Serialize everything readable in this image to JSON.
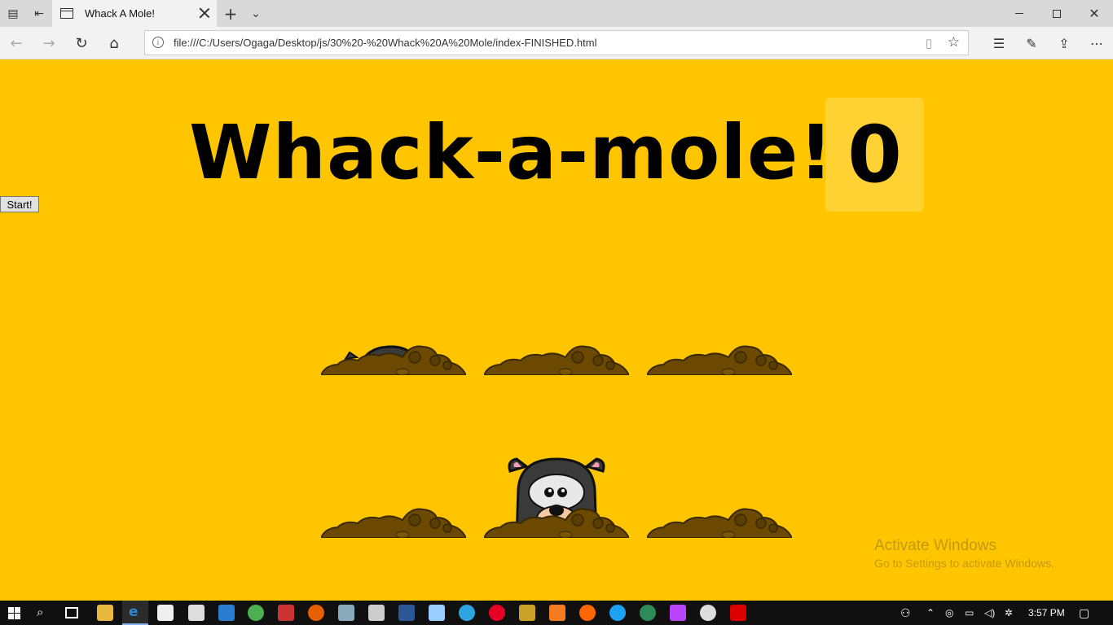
{
  "browser": {
    "tab_title": "Whack A Mole!",
    "url": "file:///C:/Users/Ogaga/Desktop/js/30%20-%20Whack%20A%20Mole/index-FINISHED.html"
  },
  "game": {
    "title": "Whack-a-mole!",
    "score": "0",
    "start_label": "Start!",
    "holes": [
      {
        "id": "hole1",
        "mole_state": "peeking"
      },
      {
        "id": "hole2",
        "mole_state": "hidden"
      },
      {
        "id": "hole3",
        "mole_state": "hidden"
      },
      {
        "id": "hole4",
        "mole_state": "hidden"
      },
      {
        "id": "hole5",
        "mole_state": "up"
      },
      {
        "id": "hole6",
        "mole_state": "hidden"
      }
    ]
  },
  "watermark": {
    "line1": "Activate Windows",
    "line2": "Go to Settings to activate Windows."
  },
  "taskbar": {
    "time": "3:57 PM"
  },
  "colors": {
    "background": "#ffc600",
    "dirt": "#6b4a00",
    "mole": "#3a3a3a"
  }
}
